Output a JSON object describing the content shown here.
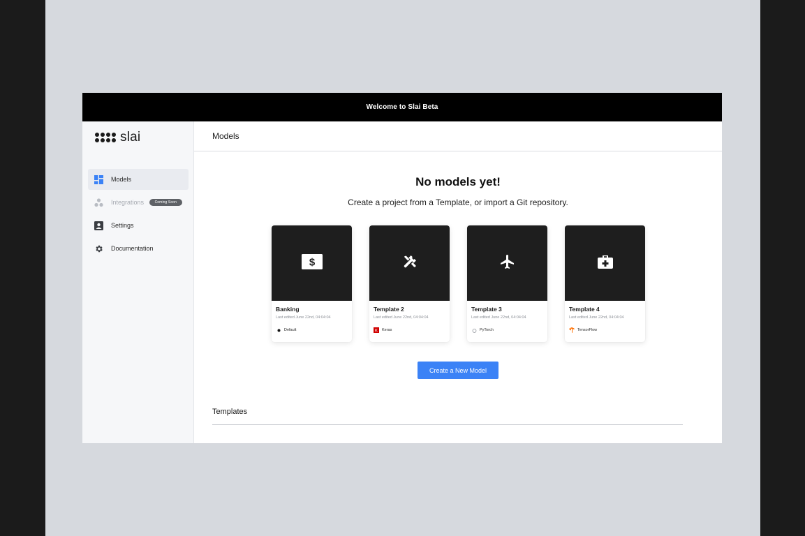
{
  "banner": {
    "text": "Welcome to Slai Beta"
  },
  "brand": {
    "name": "slai"
  },
  "sidebar": {
    "items": [
      {
        "label": "Models",
        "icon": "dashboard-icon",
        "active": true
      },
      {
        "label": "Integrations",
        "icon": "integrations-icon",
        "disabled": true,
        "badge": "Coming Soon"
      },
      {
        "label": "Settings",
        "icon": "account-box-icon"
      },
      {
        "label": "Documentation",
        "icon": "gear-icon"
      }
    ]
  },
  "main": {
    "header": "Models",
    "empty_title": "No models yet!",
    "empty_subtitle": "Create a project from a Template, or import a Git repository.",
    "cards": [
      {
        "title": "Banking",
        "date": "Last edited June 22nd, 04:04:04",
        "framework": "Default",
        "icon": "money-icon"
      },
      {
        "title": "Template 2",
        "date": "Last edited June 22nd, 04:04:04",
        "framework": "Keras",
        "icon": "tools-icon"
      },
      {
        "title": "Template 3",
        "date": "Last edited June 22nd, 04:04:04",
        "framework": "PyTorch",
        "icon": "airplane-icon"
      },
      {
        "title": "Template 4",
        "date": "Last edited June 22nd, 04:04:04",
        "framework": "TensorFlow",
        "icon": "medical-kit-icon"
      }
    ],
    "create_button": "Create a New Model",
    "templates_heading": "Templates"
  },
  "colors": {
    "accent": "#3b82f6",
    "banner_bg": "#000000",
    "card_thumb_bg": "#1e1e1e",
    "keras_red": "#d00000",
    "tensorflow_orange": "#ff6f00"
  }
}
